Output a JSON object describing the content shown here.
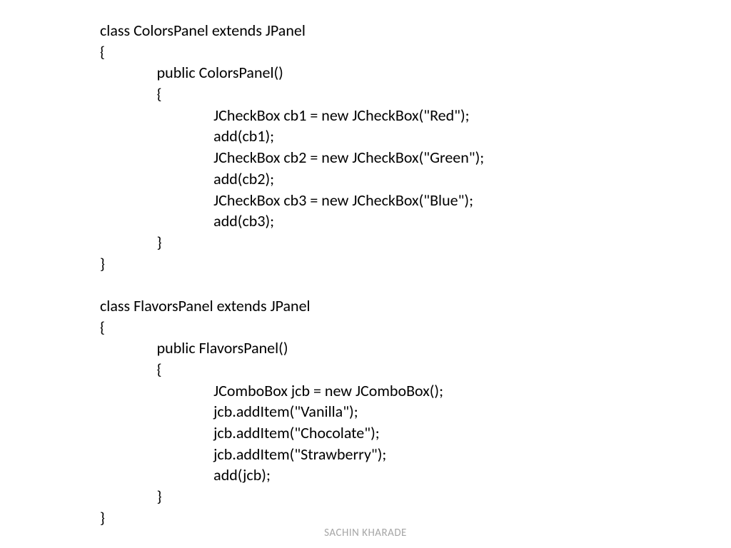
{
  "code": {
    "lines": [
      "class ColorsPanel extends JPanel",
      "{",
      "\tpublic ColorsPanel()",
      "\t{",
      "\t\tJCheckBox cb1 = new JCheckBox(\"Red\");",
      "\t\tadd(cb1);",
      "\t\tJCheckBox cb2 = new JCheckBox(\"Green\");",
      "\t\tadd(cb2);",
      "\t\tJCheckBox cb3 = new JCheckBox(\"Blue\");",
      "\t\tadd(cb3);",
      "\t}",
      "}",
      "",
      "class FlavorsPanel extends JPanel",
      "{",
      "\tpublic FlavorsPanel()",
      "\t{",
      "\t\tJComboBox jcb = new JComboBox();",
      "\t\tjcb.addItem(\"Vanilla\");",
      "\t\tjcb.addItem(\"Chocolate\");",
      "\t\tjcb.addItem(\"Strawberry\");",
      "\t\tadd(jcb);",
      "\t}",
      "}"
    ]
  },
  "footer": {
    "author": "SACHIN KHARADE"
  },
  "indent": "                "
}
